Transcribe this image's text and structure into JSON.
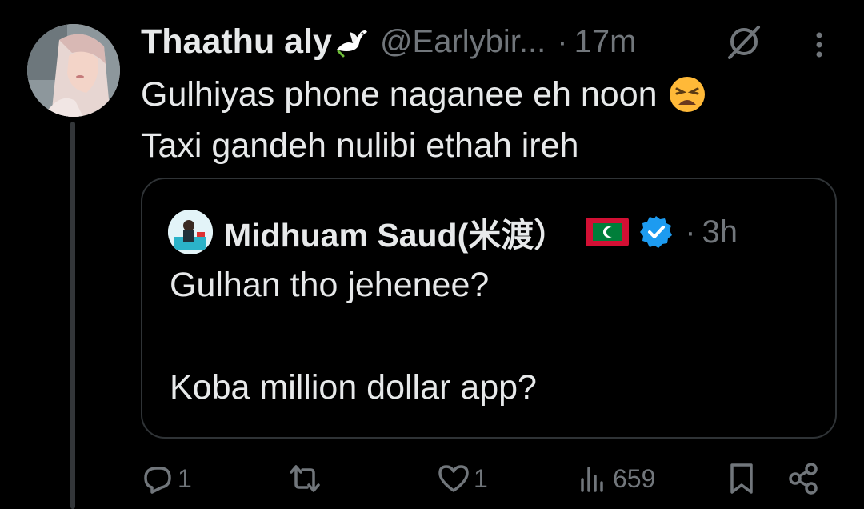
{
  "tweet": {
    "display_name": "Thaathu aly",
    "handle": "@Earlybir...",
    "separator": "·",
    "time": "17m",
    "text_line_1": "Gulhiyas phone naganee eh noon",
    "text_line_2": "Taxi gandeh nulibi ethah ireh"
  },
  "quoted_tweet": {
    "display_name": "Midhuam Saud(米渡）",
    "separator": "·",
    "time": "3h",
    "text": "Gulhan tho jehenee?\n\nKoba million dollar app?"
  },
  "actions": {
    "reply_count": "1",
    "like_count": "1",
    "views_count": "659"
  },
  "icons": {
    "dove": "dove-icon",
    "grok": "grok-icon",
    "more": "more-icon",
    "emoji": "weary-face-emoji",
    "flag": "maldives-flag-icon",
    "verified": "verified-badge-icon",
    "reply": "reply-icon",
    "retweet": "retweet-icon",
    "like": "like-icon",
    "views": "views-icon",
    "bookmark": "bookmark-icon",
    "share": "share-icon"
  },
  "colors": {
    "background": "#000000",
    "text": "#e7e9ea",
    "muted": "#71767b",
    "border": "#2f3336",
    "verified": "#1d9bf0"
  }
}
